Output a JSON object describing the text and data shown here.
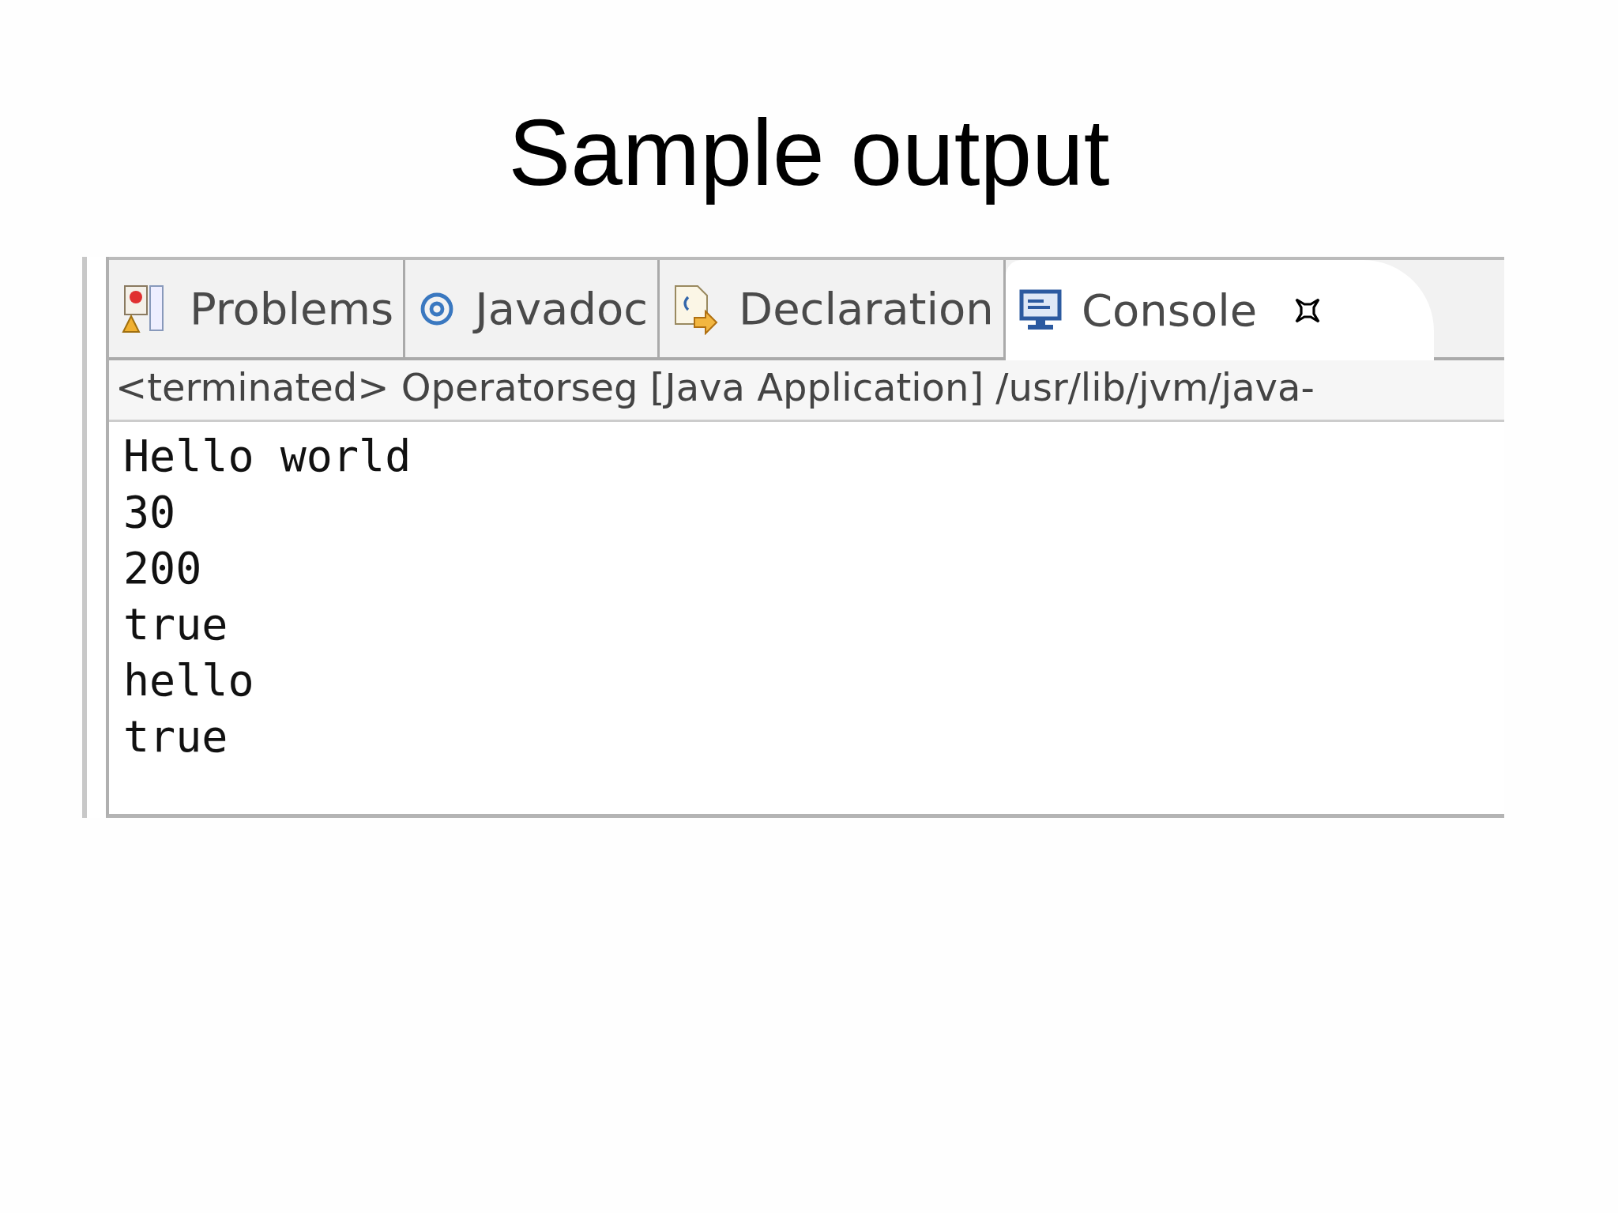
{
  "slide": {
    "title": "Sample output"
  },
  "tabs": [
    {
      "label": "Problems",
      "kind": "problems",
      "selected": false
    },
    {
      "label": "Javadoc",
      "kind": "javadoc",
      "selected": false
    },
    {
      "label": "Declaration",
      "kind": "declaration",
      "selected": false
    },
    {
      "label": "Console",
      "kind": "console",
      "selected": true
    }
  ],
  "console": {
    "status": "<terminated> Operatorseg [Java Application] /usr/lib/jvm/java-",
    "lines": [
      "Hello world",
      "30",
      "200",
      "true",
      "hello",
      "true"
    ]
  }
}
